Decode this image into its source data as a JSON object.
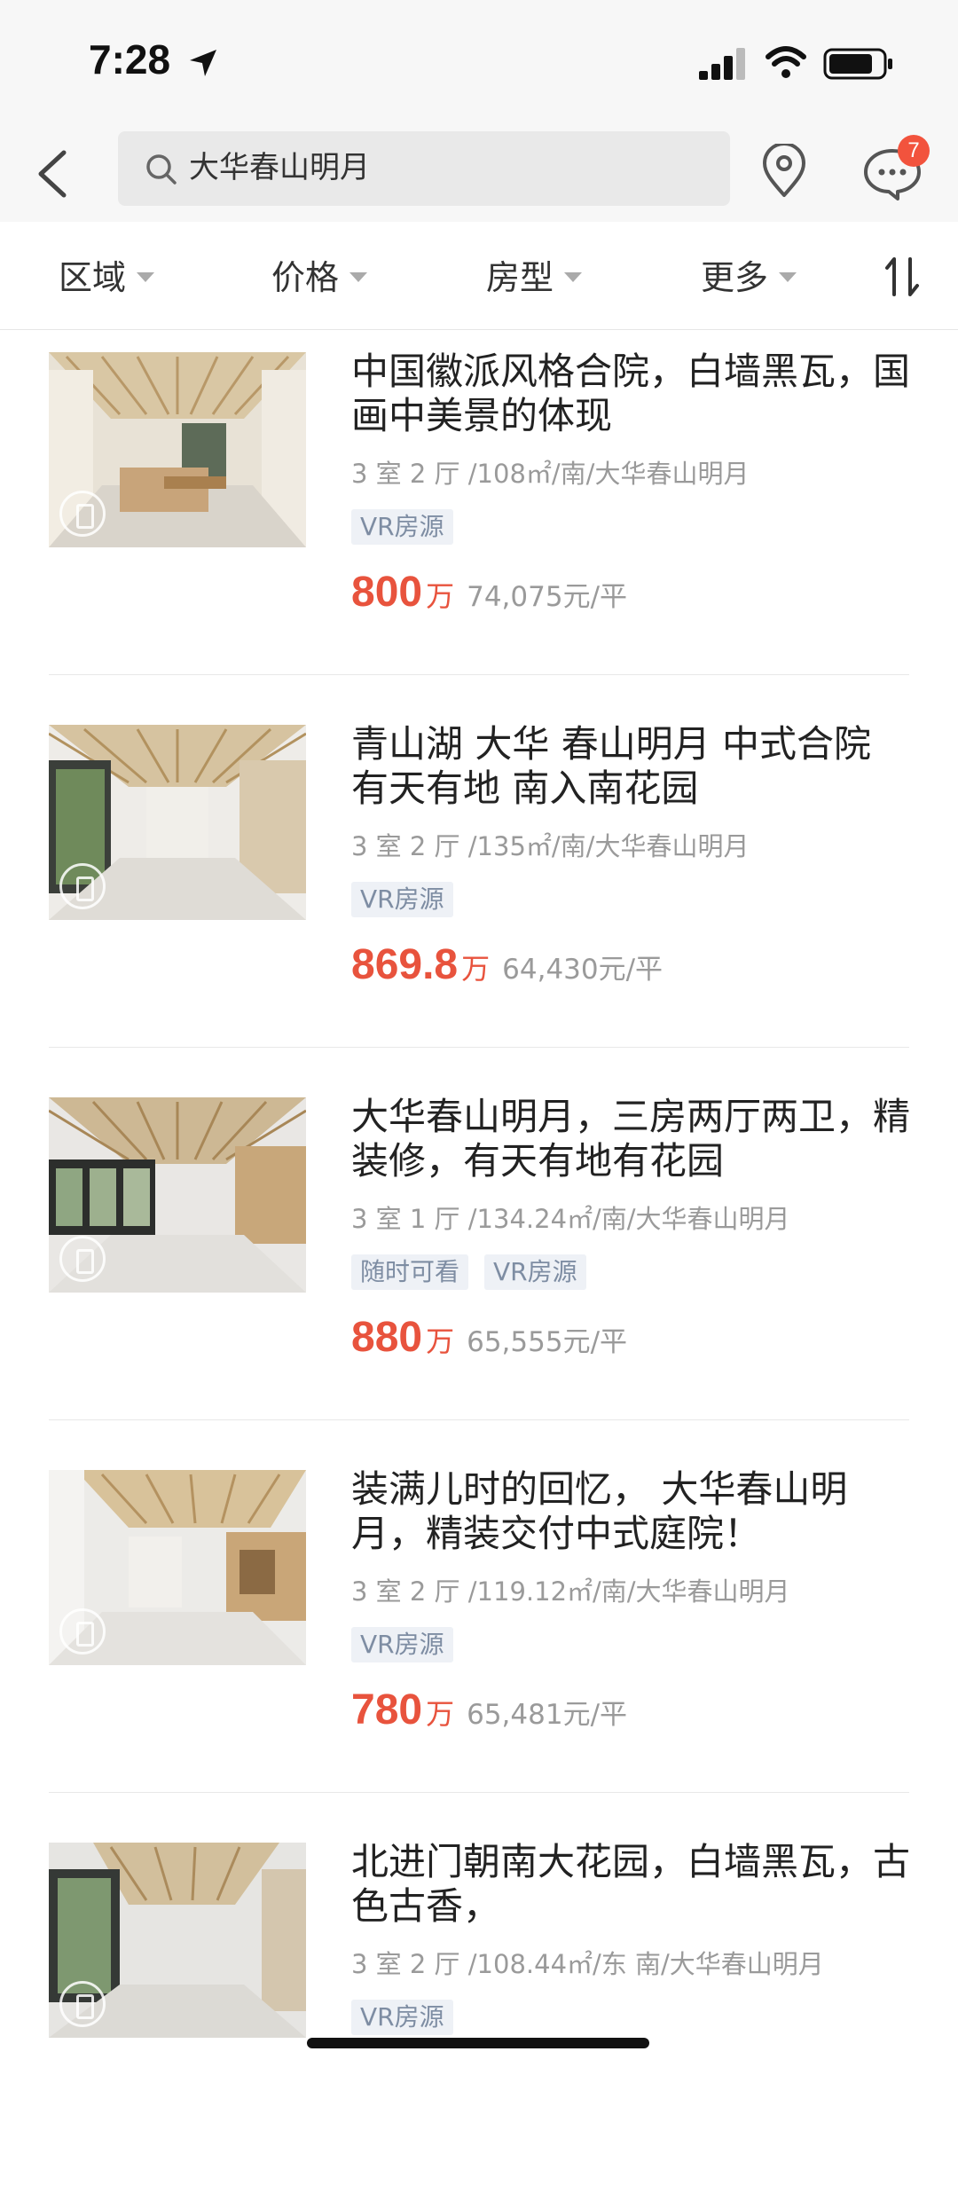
{
  "status_bar": {
    "time": "7:28"
  },
  "search": {
    "query": "大华春山明月"
  },
  "messages": {
    "badge_count": "7"
  },
  "filters": [
    "区域",
    "价格",
    "房型",
    "更多"
  ],
  "listings": [
    {
      "title": "中国徽派风格合院，白墙黑瓦，国画中美景的体现",
      "meta": "3 室 2 厅 /108㎡/南/大华春山明月",
      "tags": [
        "VR房源"
      ],
      "price": "800",
      "price_unit": "万",
      "unit_price": "74,075元/平"
    },
    {
      "title": "青山湖 大华 春山明月 中式合院 有天有地 南入南花园",
      "meta": "3 室 2 厅 /135㎡/南/大华春山明月",
      "tags": [
        "VR房源"
      ],
      "price": "869.8",
      "price_unit": "万",
      "unit_price": "64,430元/平"
    },
    {
      "title": "大华春山明月，三房两厅两卫，精装修，有天有地有花园",
      "meta": "3 室 1 厅 /134.24㎡/南/大华春山明月",
      "tags": [
        "随时可看",
        "VR房源"
      ],
      "price": "880",
      "price_unit": "万",
      "unit_price": "65,555元/平"
    },
    {
      "title": "装满儿时的回忆，  大华春山明月，精装交付中式庭院！",
      "meta": "3 室 2 厅 /119.12㎡/南/大华春山明月",
      "tags": [
        "VR房源"
      ],
      "price": "780",
      "price_unit": "万",
      "unit_price": "65,481元/平"
    },
    {
      "title": "北进门朝南大花园，白墙黑瓦，古色古香，",
      "meta": "3 室 2 厅 /108.44㎡/东 南/大华春山明月",
      "tags": [
        "VR房源"
      ],
      "price": "",
      "price_unit": "",
      "unit_price": ""
    }
  ],
  "colors": {
    "price": "#e8533d",
    "badge": "#f2533d",
    "tag_bg": "#eef1f6",
    "tag_text": "#7e8da3"
  }
}
